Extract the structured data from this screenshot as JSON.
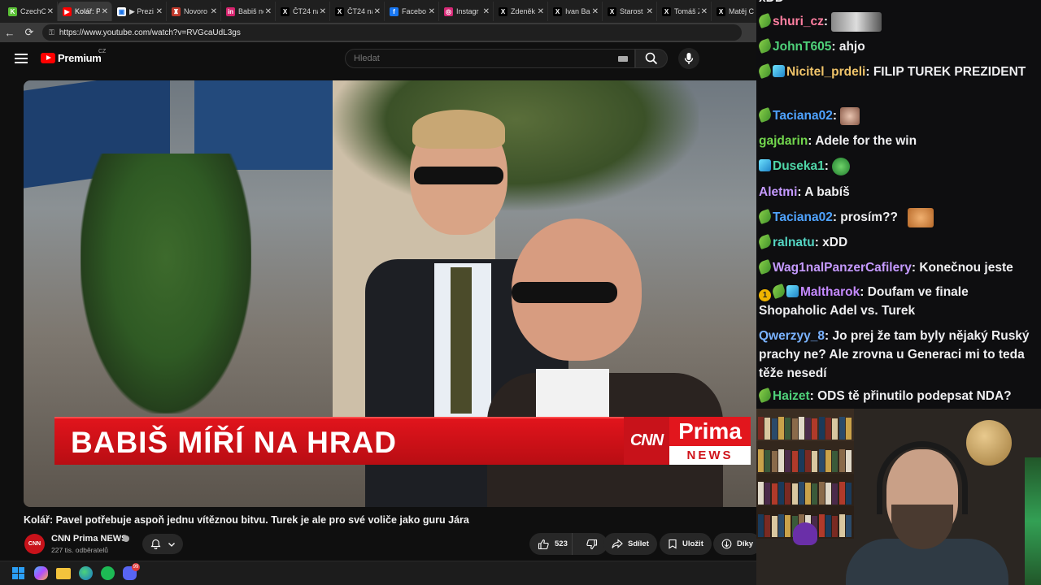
{
  "browser": {
    "tabs": [
      {
        "label": "CzechC",
        "color": "#5bc236",
        "glyph": "K",
        "active": false
      },
      {
        "label": "Kolář: P",
        "color": "#ff0000",
        "glyph": "▶",
        "active": true
      },
      {
        "label": "▶ Prezi",
        "color": "#ffffff",
        "glyph": "▣",
        "active": false
      },
      {
        "label": "Novoro",
        "color": "#c0392b",
        "glyph": "♜",
        "active": false
      },
      {
        "label": "Babiš ne",
        "color": "#d6246e",
        "glyph": "in",
        "active": false
      },
      {
        "label": "ČT24 na",
        "color": "#000000",
        "glyph": "X",
        "active": false
      },
      {
        "label": "ČT24 na",
        "color": "#000000",
        "glyph": "X",
        "active": false
      },
      {
        "label": "Facebo",
        "color": "#1877f2",
        "glyph": "f",
        "active": false
      },
      {
        "label": "Instagr",
        "color": "#d62976",
        "glyph": "◎",
        "active": false
      },
      {
        "label": "Zdeněk",
        "color": "#000000",
        "glyph": "X",
        "active": false
      },
      {
        "label": "Ivan Ba",
        "color": "#000000",
        "glyph": "X",
        "active": false
      },
      {
        "label": "Starost",
        "color": "#000000",
        "glyph": "X",
        "active": false
      },
      {
        "label": "Tomáš Z",
        "color": "#000000",
        "glyph": "X",
        "active": false
      },
      {
        "label": "Matěj C",
        "color": "#000000",
        "glyph": "X",
        "active": false
      }
    ],
    "url": "https://www.youtube.com/watch?v=RVGcaUdL3gs"
  },
  "youtube": {
    "logo_text": "Premium",
    "country": "CZ",
    "search_placeholder": "Hledat",
    "video": {
      "lower_third": "BABIŠ MÍŘÍ NA HRAD",
      "cnn": "CNN",
      "prima": "Prima",
      "news": "NEWS"
    },
    "title": "Kolář: Pavel potřebuje aspoň jednu vítěznou bitvu. Turek je ale pro své voliče jako guru Jára",
    "channel": {
      "name": "CNN Prima NEWS",
      "avatar_text": "CNN",
      "subscribers": "227 tis. odběratelů"
    },
    "actions": {
      "likes": "523",
      "share": "Sdílet",
      "save": "Uložit",
      "thanks": "Díky"
    }
  },
  "chat": {
    "messages": [
      {
        "user": "shuri_cz",
        "color": "#ff7fa1",
        "badges": [
          "green"
        ],
        "text": "",
        "emote": "photo"
      },
      {
        "user": "JohnT605",
        "color": "#4fd27a",
        "badges": [
          "green"
        ],
        "text": "ahjo"
      },
      {
        "user": "Nicitel_prdeli",
        "color": "#f0c46a",
        "badges": [
          "green",
          "cube"
        ],
        "text": "FILIP TUREK PREZIDENT"
      },
      {
        "user": "Taciana02",
        "color": "#4fa3ff",
        "badges": [
          "green"
        ],
        "text": "",
        "emote": "face"
      },
      {
        "user": "gajdarin",
        "color": "#72d64d",
        "badges": [],
        "text": "Adele for the win"
      },
      {
        "user": "Duseka1",
        "color": "#4fd6a8",
        "badges": [
          "cube"
        ],
        "text": "",
        "emote": "frog"
      },
      {
        "user": "Aletmi",
        "color": "#c59aff",
        "badges": [],
        "text": "A babíš"
      },
      {
        "user": "Taciana02",
        "color": "#4fa3ff",
        "badges": [
          "green"
        ],
        "text": "prosím??",
        "emote": "cat"
      },
      {
        "user": "ralnatu",
        "color": "#55d6c4",
        "badges": [
          "green"
        ],
        "text": "xDD"
      },
      {
        "user": "Wag1nalPanzerCafilery",
        "color": "#c59aff",
        "badges": [
          "green"
        ],
        "text": "Konečnou jeste"
      },
      {
        "user": "Maltharok",
        "color": "#c58aff",
        "badges": [
          "gold",
          "green",
          "cube"
        ],
        "text": "Doufam ve finale Shopaholic Adel vs. Turek"
      },
      {
        "user": "Qwerzyy_8",
        "color": "#7ab3ff",
        "badges": [],
        "text": "Jo prej že tam byly nějaký Ruský prachy ne? Ale zrovna u Generaci mi to teda těže nesedí"
      },
      {
        "user": "Haizet",
        "color": "#4fd27a",
        "badges": [
          "green"
        ],
        "text": "ODS tě přinutilo podepsat NDA?"
      }
    ],
    "top_partial": "xDD"
  },
  "taskbar": {
    "discord_badge": "99"
  }
}
